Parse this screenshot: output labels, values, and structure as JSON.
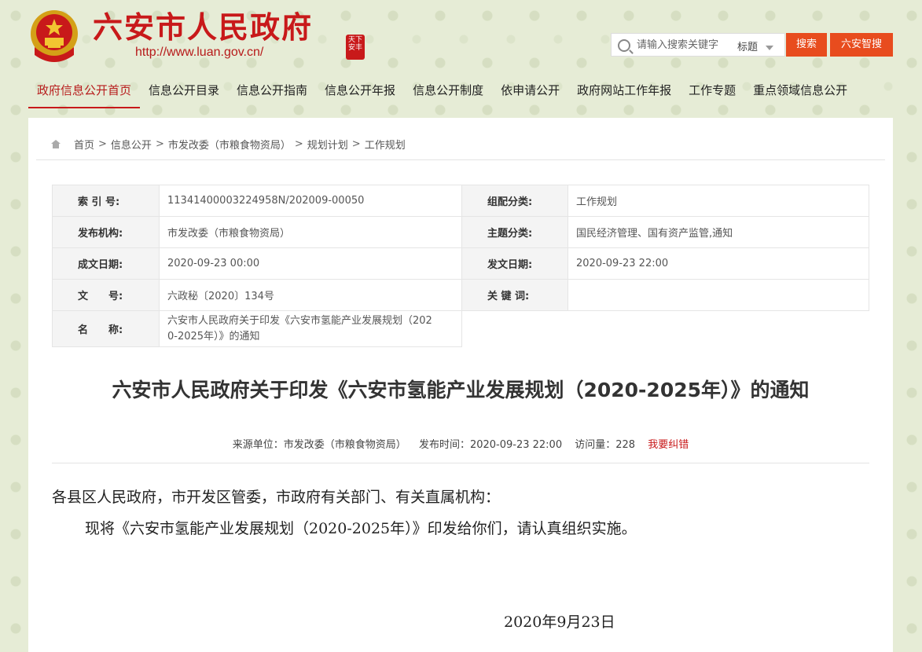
{
  "header": {
    "site_title": "六安市人民政府",
    "site_url": "http://www.luan.gov.cn/",
    "seal_text": "天下\n安丰",
    "search_placeholder": "请输入搜索关键字",
    "search_scope": "标题",
    "search_button": "搜索",
    "smart_button": "六安智搜"
  },
  "nav": [
    "政府信息公开首页",
    "信息公开目录",
    "信息公开指南",
    "信息公开年报",
    "信息公开制度",
    "依申请公开",
    "政府网站工作年报",
    "工作专题",
    "重点领域信息公开"
  ],
  "breadcrumb": [
    "首页",
    "信息公开",
    "市发改委（市粮食物资局）",
    "规划计划",
    "工作规划"
  ],
  "meta": {
    "index_label": "索 引 号:",
    "index_value": "11341400003224958N/202009-00050",
    "category_label": "组配分类:",
    "category_value": "工作规划",
    "publisher_label": "发布机构:",
    "publisher_value": "市发改委（市粮食物资局）",
    "topic_label": "主题分类:",
    "topic_value": "国民经济管理、国有资产监管,通知",
    "created_label": "成文日期:",
    "created_value": "2020-09-23 00:00",
    "issued_label": "发文日期:",
    "issued_value": "2020-09-23 22:00",
    "docno_label": "文　　号:",
    "docno_value": "六政秘〔2020〕134号",
    "keywords_label": "关 键 词:",
    "keywords_value": "",
    "name_label": "名　　称:",
    "name_value_line1": "六安市人民政府关于印发《六安市氢能产业发展规划（202",
    "name_value_line2": "0-2025年）》的通知"
  },
  "article": {
    "title": "六安市人民政府关于印发《六安市氢能产业发展规划（2020-2025年）》的通知",
    "source": "来源单位：市发改委（市粮食物资局）",
    "publish_time": "发布时间：2020-09-23 22:00",
    "visits": "访问量：228",
    "report_error": "我要纠错",
    "greeting": "各县区人民政府，市开发区管委，市政府有关部门、有关直属机构：",
    "body": "现将《六安市氢能产业发展规划（2020-2025年）》印发给你们，请认真组织实施。",
    "date": "2020年9月23日"
  },
  "colors": {
    "brand_red": "#c8191a",
    "button_orange": "#e84c1e",
    "page_background": "#e6ecd6"
  }
}
